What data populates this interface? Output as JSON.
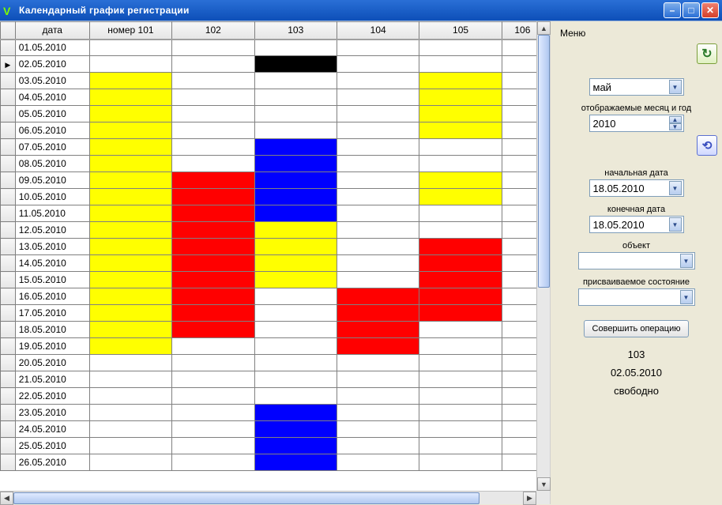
{
  "window": {
    "title": "Календарный график регистрации"
  },
  "grid": {
    "headers": [
      "дата",
      "номер 101",
      "102",
      "103",
      "104",
      "105",
      "106"
    ],
    "active_row_index": 1,
    "rows": [
      {
        "date": "01.05.2010",
        "cells": [
          "",
          "",
          "",
          "",
          "",
          ""
        ]
      },
      {
        "date": "02.05.2010",
        "cells": [
          "",
          "",
          "black",
          "",
          "",
          ""
        ]
      },
      {
        "date": "03.05.2010",
        "cells": [
          "yellow",
          "",
          "",
          "",
          "yellow",
          ""
        ]
      },
      {
        "date": "04.05.2010",
        "cells": [
          "yellow",
          "",
          "",
          "",
          "yellow",
          ""
        ]
      },
      {
        "date": "05.05.2010",
        "cells": [
          "yellow",
          "",
          "",
          "",
          "yellow",
          ""
        ]
      },
      {
        "date": "06.05.2010",
        "cells": [
          "yellow",
          "",
          "",
          "",
          "yellow",
          ""
        ]
      },
      {
        "date": "07.05.2010",
        "cells": [
          "yellow",
          "",
          "blue",
          "",
          "",
          ""
        ]
      },
      {
        "date": "08.05.2010",
        "cells": [
          "yellow",
          "",
          "blue",
          "",
          "",
          ""
        ]
      },
      {
        "date": "09.05.2010",
        "cells": [
          "yellow",
          "red",
          "blue",
          "",
          "yellow",
          ""
        ]
      },
      {
        "date": "10.05.2010",
        "cells": [
          "yellow",
          "red",
          "blue",
          "",
          "yellow",
          ""
        ]
      },
      {
        "date": "11.05.2010",
        "cells": [
          "yellow",
          "red",
          "blue",
          "",
          "",
          ""
        ]
      },
      {
        "date": "12.05.2010",
        "cells": [
          "yellow",
          "red",
          "yellow",
          "",
          "",
          ""
        ]
      },
      {
        "date": "13.05.2010",
        "cells": [
          "yellow",
          "red",
          "yellow",
          "",
          "red",
          ""
        ]
      },
      {
        "date": "14.05.2010",
        "cells": [
          "yellow",
          "red",
          "yellow",
          "",
          "red",
          ""
        ]
      },
      {
        "date": "15.05.2010",
        "cells": [
          "yellow",
          "red",
          "yellow",
          "",
          "red",
          ""
        ]
      },
      {
        "date": "16.05.2010",
        "cells": [
          "yellow",
          "red",
          "",
          "red",
          "red",
          ""
        ]
      },
      {
        "date": "17.05.2010",
        "cells": [
          "yellow",
          "red",
          "",
          "red",
          "red",
          ""
        ]
      },
      {
        "date": "18.05.2010",
        "cells": [
          "yellow",
          "red",
          "",
          "red",
          "",
          ""
        ]
      },
      {
        "date": "19.05.2010",
        "cells": [
          "yellow",
          "",
          "",
          "red",
          "",
          ""
        ]
      },
      {
        "date": "20.05.2010",
        "cells": [
          "",
          "",
          "",
          "",
          "",
          ""
        ]
      },
      {
        "date": "21.05.2010",
        "cells": [
          "",
          "",
          "",
          "",
          "",
          ""
        ]
      },
      {
        "date": "22.05.2010",
        "cells": [
          "",
          "",
          "",
          "",
          "",
          ""
        ]
      },
      {
        "date": "23.05.2010",
        "cells": [
          "",
          "",
          "blue",
          "",
          "",
          ""
        ]
      },
      {
        "date": "24.05.2010",
        "cells": [
          "",
          "",
          "blue",
          "",
          "",
          ""
        ]
      },
      {
        "date": "25.05.2010",
        "cells": [
          "",
          "",
          "blue",
          "",
          "",
          ""
        ]
      },
      {
        "date": "26.05.2010",
        "cells": [
          "",
          "",
          "blue",
          "",
          "",
          ""
        ]
      }
    ]
  },
  "side": {
    "menu_label": "Меню",
    "month_value": "май",
    "month_year_label": "отображаемые месяц и год",
    "year_value": "2010",
    "start_date_label": "начальная дата",
    "start_date_value": "18.05.2010",
    "end_date_label": "конечная дата",
    "end_date_value": "18.05.2010",
    "object_label": "объект",
    "object_value": "",
    "state_label": "присваиваемое состояние",
    "state_value": "",
    "operate_button": "Совершить операцию",
    "info_room": "103",
    "info_date": "02.05.2010",
    "info_status": "свободно"
  }
}
